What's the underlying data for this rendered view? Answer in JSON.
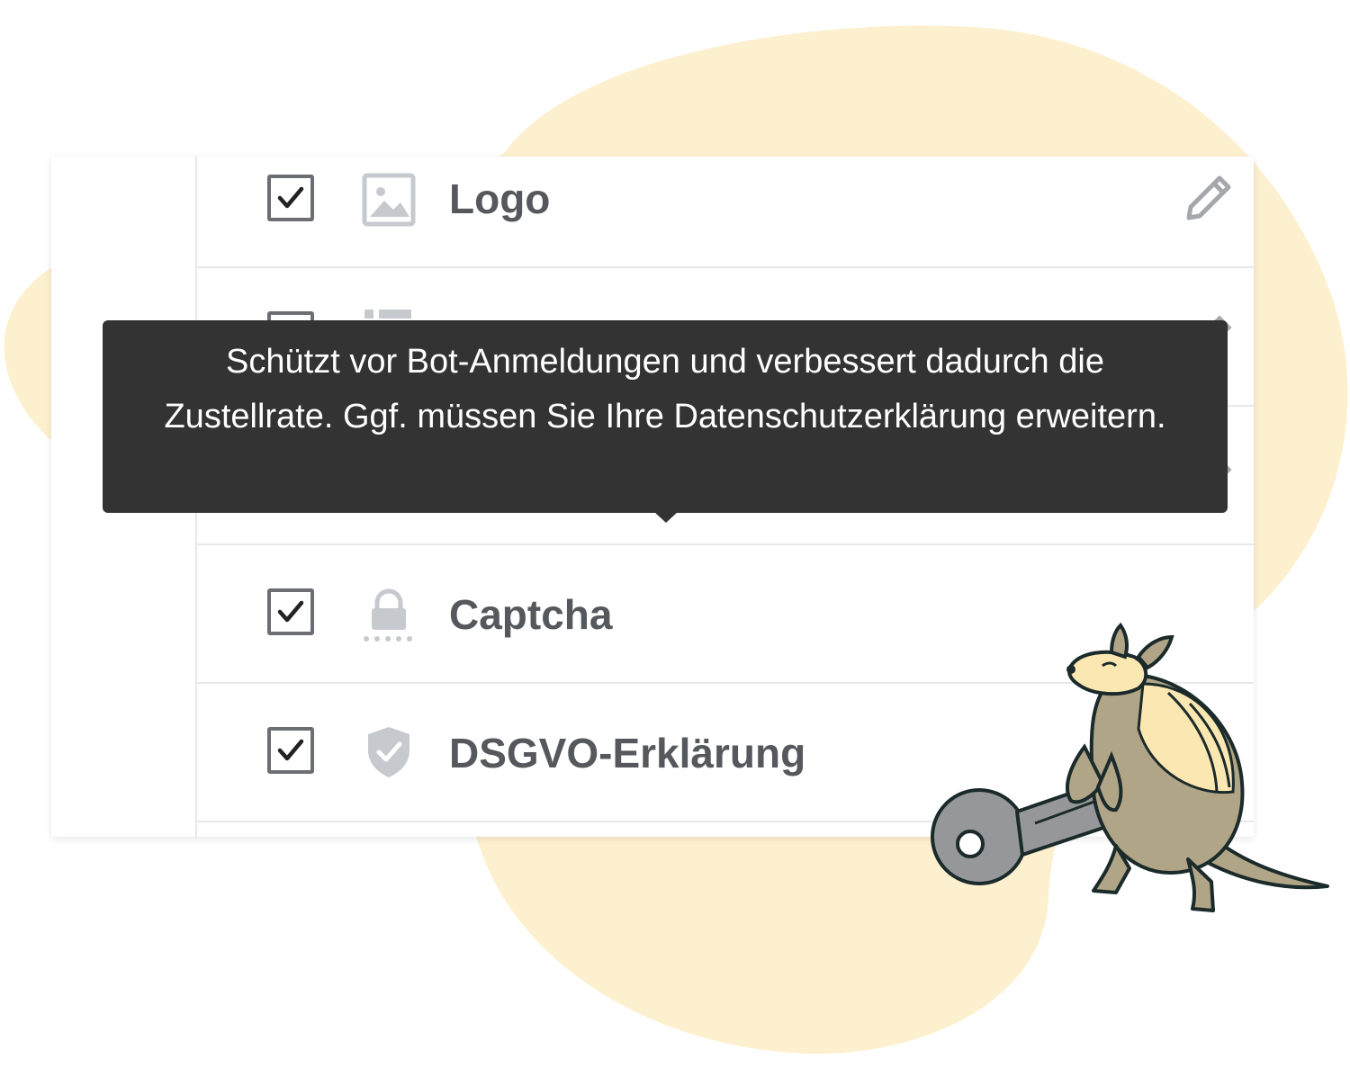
{
  "colors": {
    "background_blob": "#fdf0cf",
    "text_label": "#55585c",
    "checkbox_border": "#6b6e72",
    "icon_muted": "#c6cace",
    "tooltip_bg": "#333333",
    "tooltip_text": "#ffffff",
    "divider": "#e6e8ec"
  },
  "list": {
    "items": [
      {
        "label": "Logo",
        "checked": true,
        "icon": "image-icon",
        "has_edit": true
      },
      {
        "label": "",
        "checked": true,
        "icon": "list-icon",
        "has_edit": true
      },
      {
        "label": "",
        "checked": true,
        "icon": "unknown-icon",
        "has_edit": true
      },
      {
        "label": "Captcha",
        "checked": true,
        "icon": "lock-icon",
        "has_edit": false
      },
      {
        "label": "DSGVO-Erklärung",
        "checked": true,
        "icon": "shield-check-icon",
        "has_edit": false
      }
    ]
  },
  "tooltip": {
    "text": "Schützt vor Bot-Anmeldungen und verbessert dadurch die Zustellrate. Ggf. müssen Sie Ihre Datenschutzerklärung erweitern."
  },
  "mascot": {
    "description_icon": "armadillo-with-key-icon"
  }
}
